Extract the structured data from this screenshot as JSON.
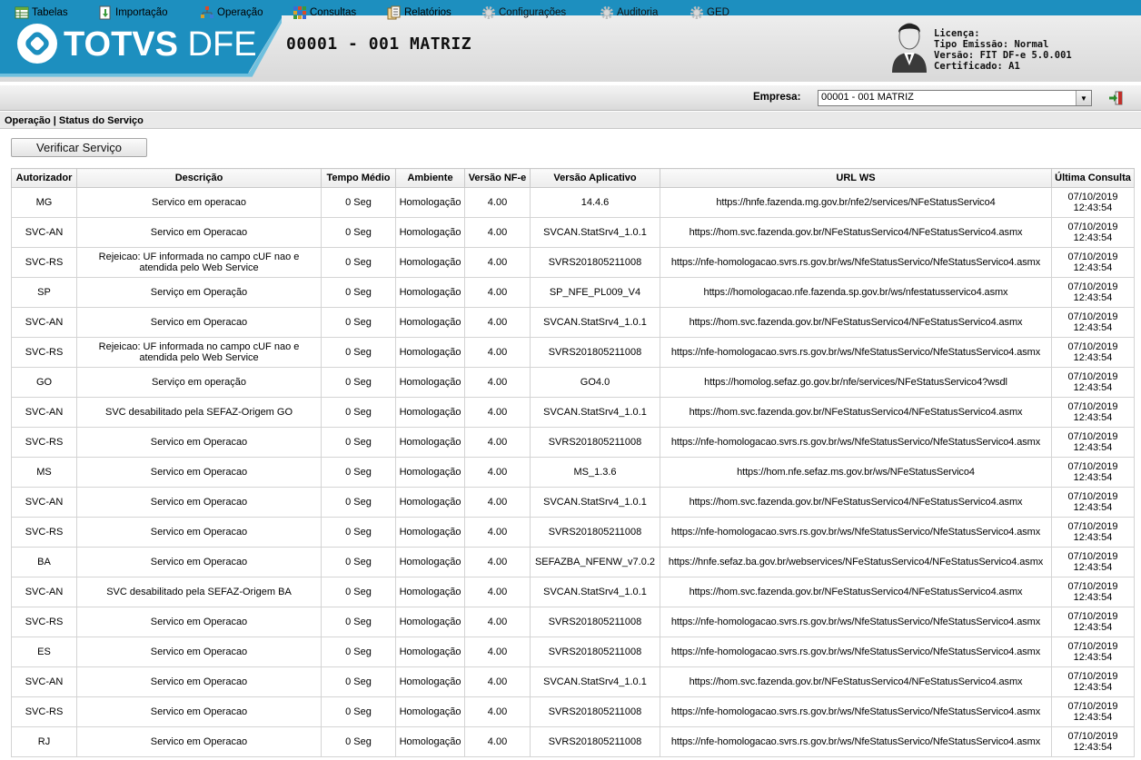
{
  "header": {
    "brand_bold": "TOTVS",
    "brand_light": " DFE",
    "company_title": "00001 - 001 MATRIZ",
    "license_lines": [
      "Licença:",
      "Tipo Emissão: Normal",
      "Versão: FIT DF-e 5.0.001",
      "Certificado: A1"
    ]
  },
  "menu": {
    "items": [
      {
        "label": "Tabelas",
        "icon": "table-icon"
      },
      {
        "label": "Importação",
        "icon": "import-icon"
      },
      {
        "label": "Operação",
        "icon": "operation-icon"
      },
      {
        "label": "Consultas",
        "icon": "query-icon"
      },
      {
        "label": "Relatórios",
        "icon": "report-icon"
      },
      {
        "label": "Configurações",
        "icon": "gear-icon"
      },
      {
        "label": "Auditoria",
        "icon": "gear-icon"
      },
      {
        "label": "GED",
        "icon": "gear-icon"
      }
    ],
    "empresa_label": "Empresa:",
    "empresa_value": "00001 - 001 MATRIZ"
  },
  "breadcrumb": "Operação | Status do Serviço",
  "verify_button": "Verificar Serviço",
  "table": {
    "columns": [
      "Autorizador",
      "Descrição",
      "Tempo Médio",
      "Ambiente",
      "Versão NF-e",
      "Versão Aplicativo",
      "URL WS",
      "Última Consulta"
    ],
    "rows": [
      [
        "MG",
        "Servico em operacao",
        "0 Seg",
        "Homologação",
        "4.00",
        "14.4.6",
        "https://hnfe.fazenda.mg.gov.br/nfe2/services/NFeStatusServico4",
        "07/10/2019",
        "12:43:54"
      ],
      [
        "SVC-AN",
        "Servico em Operacao",
        "0 Seg",
        "Homologação",
        "4.00",
        "SVCAN.StatSrv4_1.0.1",
        "https://hom.svc.fazenda.gov.br/NFeStatusServico4/NFeStatusServico4.asmx",
        "07/10/2019",
        "12:43:54"
      ],
      [
        "SVC-RS",
        "Rejeicao: UF informada no campo cUF nao e atendida pelo Web Service",
        "0 Seg",
        "Homologação",
        "4.00",
        "SVRS201805211008",
        "https://nfe-homologacao.svrs.rs.gov.br/ws/NfeStatusServico/NfeStatusServico4.asmx",
        "07/10/2019",
        "12:43:54"
      ],
      [
        "SP",
        "Serviço em Operação",
        "0 Seg",
        "Homologação",
        "4.00",
        "SP_NFE_PL009_V4",
        "https://homologacao.nfe.fazenda.sp.gov.br/ws/nfestatusservico4.asmx",
        "07/10/2019",
        "12:43:54"
      ],
      [
        "SVC-AN",
        "Servico em Operacao",
        "0 Seg",
        "Homologação",
        "4.00",
        "SVCAN.StatSrv4_1.0.1",
        "https://hom.svc.fazenda.gov.br/NFeStatusServico4/NFeStatusServico4.asmx",
        "07/10/2019",
        "12:43:54"
      ],
      [
        "SVC-RS",
        "Rejeicao: UF informada no campo cUF nao e atendida pelo Web Service",
        "0 Seg",
        "Homologação",
        "4.00",
        "SVRS201805211008",
        "https://nfe-homologacao.svrs.rs.gov.br/ws/NfeStatusServico/NfeStatusServico4.asmx",
        "07/10/2019",
        "12:43:54"
      ],
      [
        "GO",
        "Serviço em operação",
        "0 Seg",
        "Homologação",
        "4.00",
        "GO4.0",
        "https://homolog.sefaz.go.gov.br/nfe/services/NFeStatusServico4?wsdl",
        "07/10/2019",
        "12:43:54"
      ],
      [
        "SVC-AN",
        "SVC desabilitado pela SEFAZ-Origem GO",
        "0 Seg",
        "Homologação",
        "4.00",
        "SVCAN.StatSrv4_1.0.1",
        "https://hom.svc.fazenda.gov.br/NFeStatusServico4/NFeStatusServico4.asmx",
        "07/10/2019",
        "12:43:54"
      ],
      [
        "SVC-RS",
        "Servico em Operacao",
        "0 Seg",
        "Homologação",
        "4.00",
        "SVRS201805211008",
        "https://nfe-homologacao.svrs.rs.gov.br/ws/NfeStatusServico/NfeStatusServico4.asmx",
        "07/10/2019",
        "12:43:54"
      ],
      [
        "MS",
        "Servico em Operacao",
        "0 Seg",
        "Homologação",
        "4.00",
        "MS_1.3.6",
        "https://hom.nfe.sefaz.ms.gov.br/ws/NFeStatusServico4",
        "07/10/2019",
        "12:43:54"
      ],
      [
        "SVC-AN",
        "Servico em Operacao",
        "0 Seg",
        "Homologação",
        "4.00",
        "SVCAN.StatSrv4_1.0.1",
        "https://hom.svc.fazenda.gov.br/NFeStatusServico4/NFeStatusServico4.asmx",
        "07/10/2019",
        "12:43:54"
      ],
      [
        "SVC-RS",
        "Servico em Operacao",
        "0 Seg",
        "Homologação",
        "4.00",
        "SVRS201805211008",
        "https://nfe-homologacao.svrs.rs.gov.br/ws/NfeStatusServico/NfeStatusServico4.asmx",
        "07/10/2019",
        "12:43:54"
      ],
      [
        "BA",
        "Servico em Operacao",
        "0 Seg",
        "Homologação",
        "4.00",
        "SEFAZBA_NFENW_v7.0.2",
        "https://hnfe.sefaz.ba.gov.br/webservices/NFeStatusServico4/NFeStatusServico4.asmx",
        "07/10/2019",
        "12:43:54"
      ],
      [
        "SVC-AN",
        "SVC desabilitado pela SEFAZ-Origem BA",
        "0 Seg",
        "Homologação",
        "4.00",
        "SVCAN.StatSrv4_1.0.1",
        "https://hom.svc.fazenda.gov.br/NFeStatusServico4/NFeStatusServico4.asmx",
        "07/10/2019",
        "12:43:54"
      ],
      [
        "SVC-RS",
        "Servico em Operacao",
        "0 Seg",
        "Homologação",
        "4.00",
        "SVRS201805211008",
        "https://nfe-homologacao.svrs.rs.gov.br/ws/NfeStatusServico/NfeStatusServico4.asmx",
        "07/10/2019",
        "12:43:54"
      ],
      [
        "ES",
        "Servico em Operacao",
        "0 Seg",
        "Homologação",
        "4.00",
        "SVRS201805211008",
        "https://nfe-homologacao.svrs.rs.gov.br/ws/NfeStatusServico/NfeStatusServico4.asmx",
        "07/10/2019",
        "12:43:54"
      ],
      [
        "SVC-AN",
        "Servico em Operacao",
        "0 Seg",
        "Homologação",
        "4.00",
        "SVCAN.StatSrv4_1.0.1",
        "https://hom.svc.fazenda.gov.br/NFeStatusServico4/NFeStatusServico4.asmx",
        "07/10/2019",
        "12:43:54"
      ],
      [
        "SVC-RS",
        "Servico em Operacao",
        "0 Seg",
        "Homologação",
        "4.00",
        "SVRS201805211008",
        "https://nfe-homologacao.svrs.rs.gov.br/ws/NfeStatusServico/NfeStatusServico4.asmx",
        "07/10/2019",
        "12:43:54"
      ],
      [
        "RJ",
        "Servico em Operacao",
        "0 Seg",
        "Homologação",
        "4.00",
        "SVRS201805211008",
        "https://nfe-homologacao.svrs.rs.gov.br/ws/NfeStatusServico/NfeStatusServico4.asmx",
        "07/10/2019",
        "12:43:54"
      ]
    ]
  },
  "colors": {
    "brand_blue": "#1d8fbf",
    "brand_blue_light": "#6fc0de"
  }
}
